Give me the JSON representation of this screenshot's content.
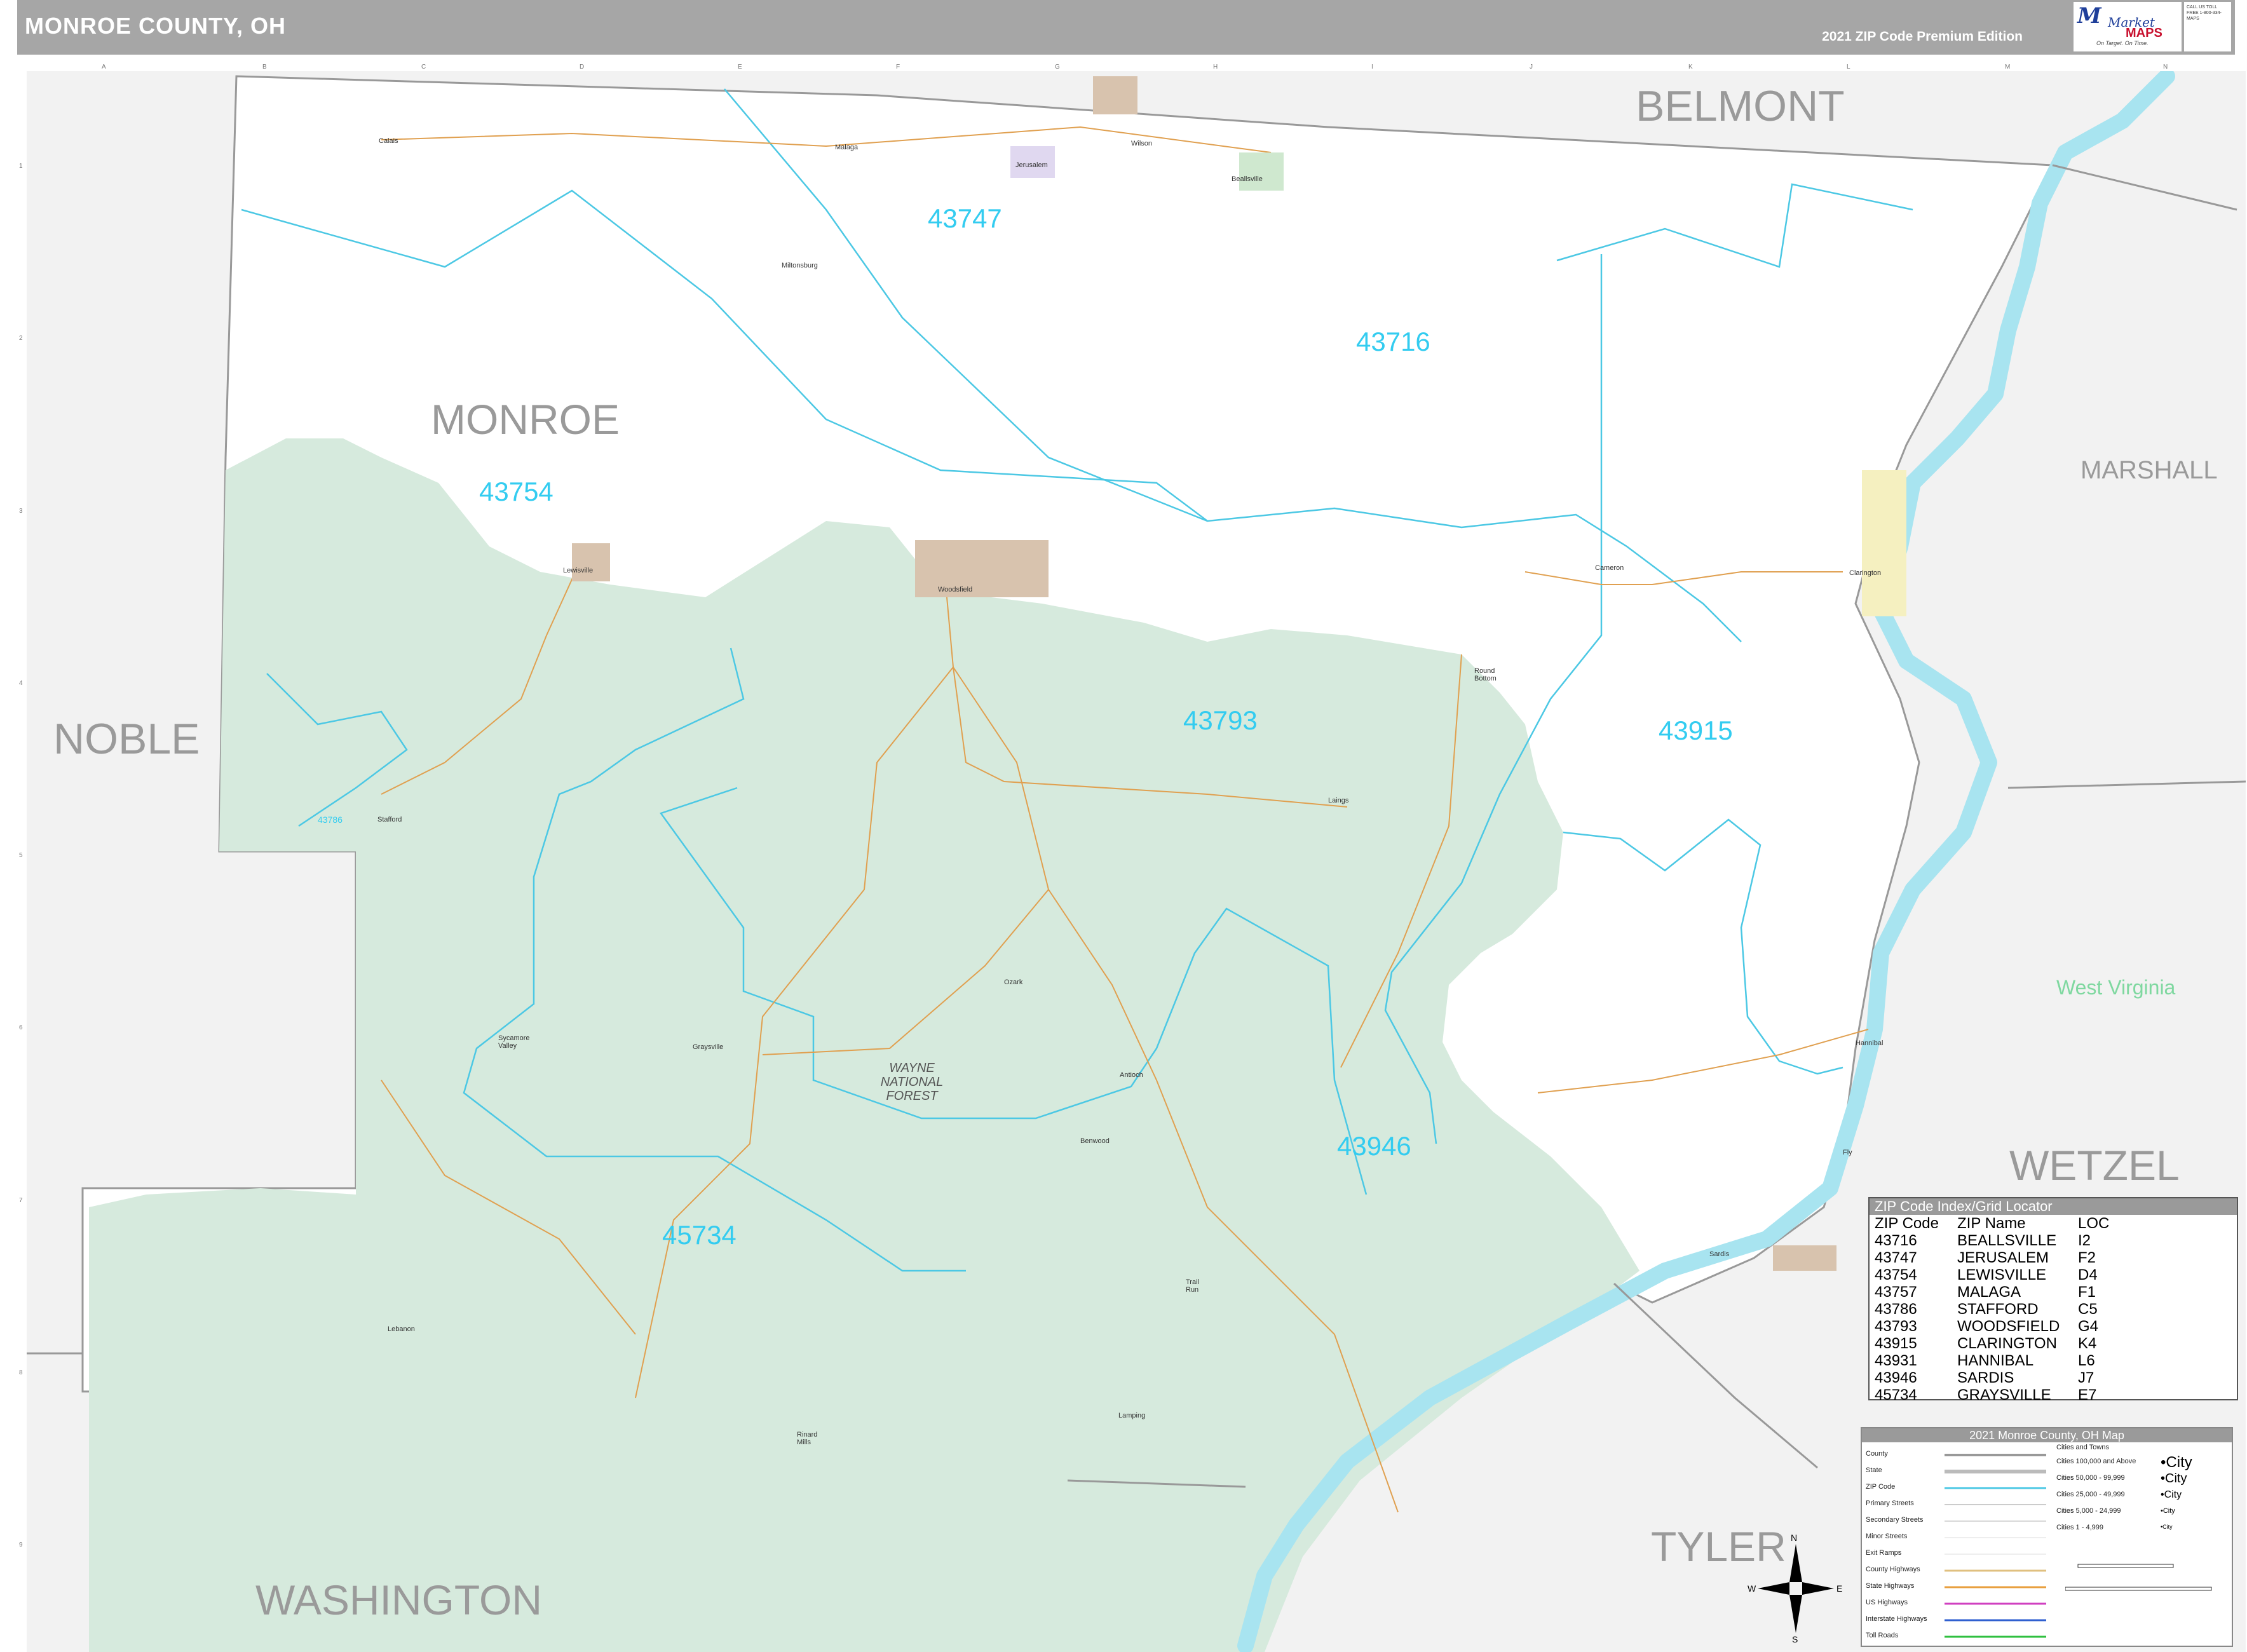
{
  "header": {
    "title": "MONROE COUNTY, OH",
    "edition": "2021 ZIP Code Premium Edition"
  },
  "logo": {
    "brand_line1": "Market",
    "brand_line2": "MAPS",
    "tagline": "On Target. On Time.",
    "info": "CALL US TOLL FREE 1-800-334-MAPS"
  },
  "grid": {
    "columns": [
      "A",
      "B",
      "C",
      "D",
      "E",
      "F",
      "G",
      "H",
      "I",
      "J",
      "K",
      "L",
      "M",
      "N"
    ],
    "rows": [
      "1",
      "2",
      "3",
      "4",
      "5",
      "6",
      "7",
      "8",
      "9"
    ]
  },
  "regions": {
    "counties": [
      "BELMONT",
      "MARSHALL",
      "NOBLE",
      "WETZEL",
      "TYLER",
      "WASHINGTON",
      "MONROE"
    ],
    "state": "West Virginia",
    "forest": "WAYNE NATIONAL FOREST"
  },
  "zip_labels": [
    "43747",
    "43716",
    "43754",
    "43793",
    "43915",
    "43946",
    "45734",
    "43786"
  ],
  "places": [
    "Lewisville",
    "Woodsfield",
    "Clarington",
    "Hannibal",
    "Sardis",
    "Graysville",
    "Malaga",
    "Jerusalem",
    "Beallsville",
    "Stafford",
    "Antioch",
    "Rinard Mills",
    "Laings",
    "Lebanon",
    "Miltonsburg",
    "Ozark",
    "Round Bottom",
    "Sycamore Valley",
    "Benwood",
    "Calais",
    "Wilson",
    "Cameron",
    "Trail Run",
    "Fly",
    "Lamping"
  ],
  "colors": {
    "forest": "#d6eadd",
    "water": "#a8e4f0",
    "zip_label": "#33ccf0",
    "zip_line": "#4cc8e4",
    "county_line": "#999999",
    "road": "#e0a050"
  },
  "compass": {
    "n": "N",
    "s": "S",
    "e": "E",
    "w": "W"
  },
  "index": {
    "title": "ZIP Code Index/Grid Locator",
    "columns": [
      "ZIP Code",
      "ZIP Name",
      "LOC"
    ],
    "rows": [
      [
        "43716",
        "BEALLSVILLE",
        "I2"
      ],
      [
        "43747",
        "JERUSALEM",
        "F2"
      ],
      [
        "43754",
        "LEWISVILLE",
        "D4"
      ],
      [
        "43757",
        "MALAGA",
        "F1"
      ],
      [
        "43786",
        "STAFFORD",
        "C5"
      ],
      [
        "43793",
        "WOODSFIELD",
        "G4"
      ],
      [
        "43915",
        "CLARINGTON",
        "K4"
      ],
      [
        "43931",
        "HANNIBAL",
        "L6"
      ],
      [
        "43946",
        "SARDIS",
        "J7"
      ],
      [
        "45734",
        "GRAYSVILLE",
        "E7"
      ]
    ]
  },
  "legend": {
    "title": "2021 Monroe County, OH Map",
    "items": [
      "County",
      "State",
      "ZIP Code",
      "Primary Streets",
      "Secondary Streets",
      "Minor Streets",
      "Exit Ramps",
      "County Highways",
      "State Highways",
      "US Highways",
      "Interstate Highways",
      "Toll Roads"
    ],
    "cities_title": "Cities and Towns",
    "city_classes": [
      "Cities 100,000 and Above",
      "Cities 50,000 - 99,999",
      "Cities 25,000 - 49,999",
      "Cities 5,000 - 24,999",
      "Cities 1 - 4,999"
    ],
    "city_symbols": [
      "•City",
      "•City",
      "•City",
      "•City",
      "•City"
    ]
  }
}
